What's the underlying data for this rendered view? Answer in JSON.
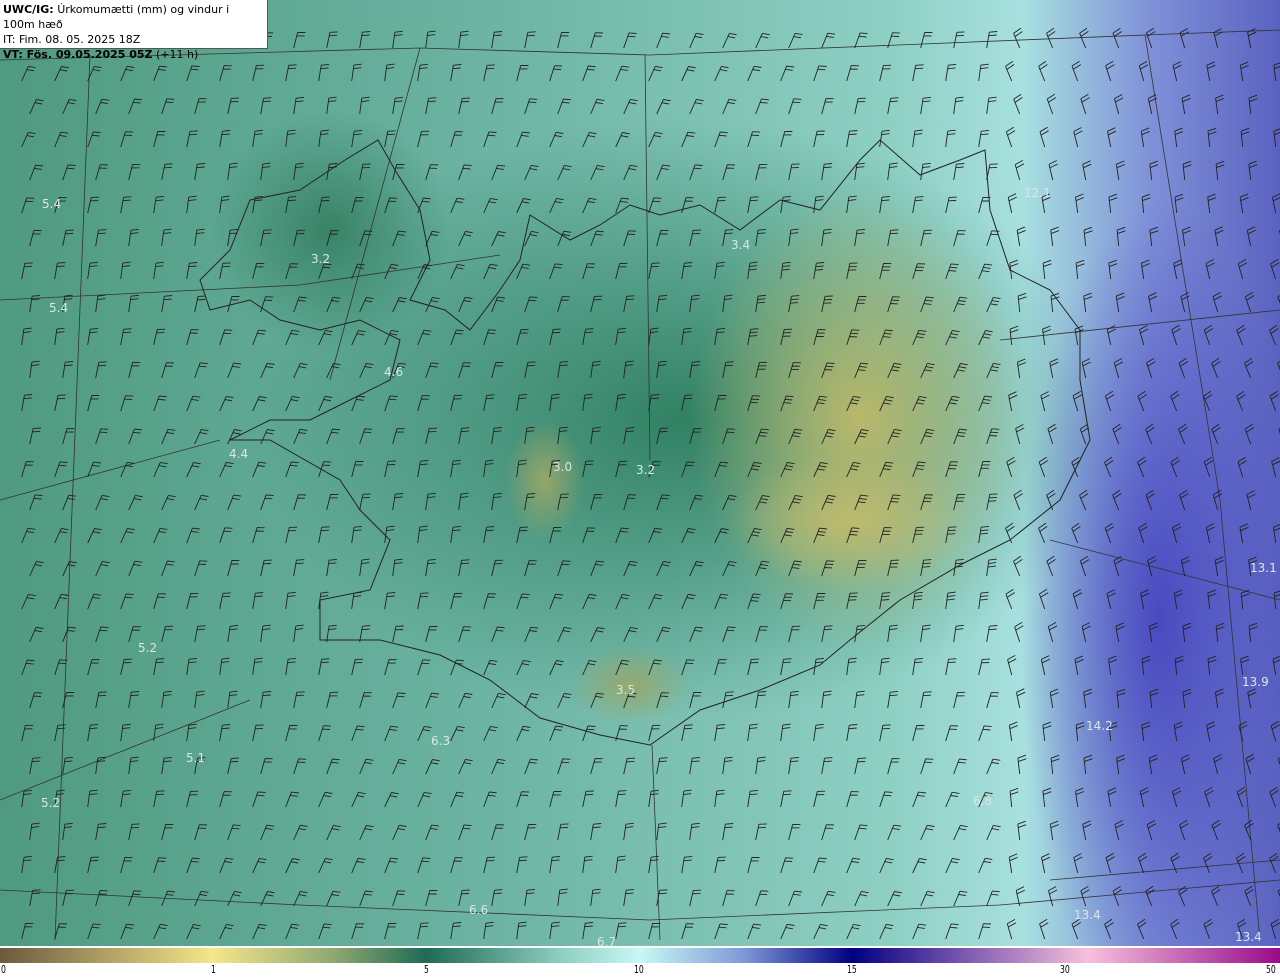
{
  "header": {
    "model": "UWC/IG:",
    "title": "Úrkomumætti (mm) og vindur i 100m hæð",
    "init_time": "IT: Fim. 08. 05. 2025 18Z",
    "valid_label": "VT: Fös. 09.05.2025 05Z",
    "lead": "(+11 h)"
  },
  "values": [
    "5.4",
    "5.4",
    "3.2",
    "4.6",
    "4.4",
    "3.0",
    "3.2",
    "3.4",
    "12.1",
    "13.1",
    "13.9",
    "14.2",
    "5.2",
    "5.1",
    "5.2",
    "6.3",
    "3.5",
    "6.8",
    "6.6",
    "6.7",
    "13.4",
    "13.4"
  ],
  "colorbar": {
    "ticks": [
      "0",
      "1",
      "5",
      "10",
      "15",
      "30",
      "50"
    ],
    "colors": [
      "#6b5a3e",
      "#f5e68a",
      "#1f6b55",
      "#c8f8f4",
      "#000080",
      "#f8c0dc",
      "#9a0a8a"
    ]
  }
}
